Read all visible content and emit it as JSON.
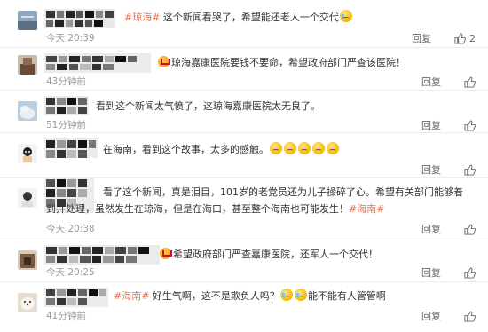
{
  "comments": [
    {
      "tag": "#琼海#",
      "text": " 这个新闻看哭了，希望能还老人一个交代",
      "emojis_after": [
        "cry"
      ],
      "vip": false,
      "time": "今天 20:39",
      "reply_label": "回复",
      "like_count": "2"
    },
    {
      "tag": "",
      "text": "琼海嘉康医院要钱不要命，希望政府部门严查该医院！",
      "emojis_after": [],
      "vip": true,
      "time": "43分钟前",
      "reply_label": "回复",
      "like_count": ""
    },
    {
      "tag": "",
      "text": "看到这个新闻太气愤了，这琼海嘉康医院太无良了。",
      "emojis_after": [],
      "vip": false,
      "time": "51分钟前",
      "reply_label": "回复",
      "like_count": ""
    },
    {
      "tag": "",
      "text": "在海南，看到这个故事，太多的感触。",
      "emojis_after": [
        "sad",
        "sad",
        "sad",
        "sad",
        "sad"
      ],
      "vip": false,
      "time": "",
      "reply_label": "回复",
      "like_count": ""
    },
    {
      "tag": "",
      "text": "看了这个新闻，真是泪目，101岁的老党员还为儿子操碎了心。希望有关部门能够着到并处理，虽然发生在琼海，但是在海口，甚至整个海南也可能发生！",
      "tag_after": "#海南#",
      "emojis_after": [],
      "vip": false,
      "time": "今天 20:38",
      "reply_label": "回复",
      "like_count": ""
    },
    {
      "tag": "",
      "text": "希望政府部门严查嘉康医院，还军人一个交代！",
      "emojis_after": [],
      "vip": true,
      "time": "今天 20:25",
      "reply_label": "回复",
      "like_count": ""
    },
    {
      "tag": "#海南#",
      "text": " 好生气啊，这不是欺负人吗？",
      "emojis_after": [
        "cry",
        "cry"
      ],
      "text_after": "能不能有人管管啊",
      "vip": false,
      "time": "41分钟前",
      "reply_label": "回复",
      "like_count": ""
    }
  ],
  "colors": {
    "tag": "#eb7350",
    "text": "#333333",
    "muted": "#999999",
    "divider": "#ededed"
  },
  "icons": {
    "like": "thumb-up-icon",
    "emoji_cry": "crying-face-icon",
    "emoji_sad": "sad-face-icon",
    "vip": "vip-crown-icon"
  }
}
